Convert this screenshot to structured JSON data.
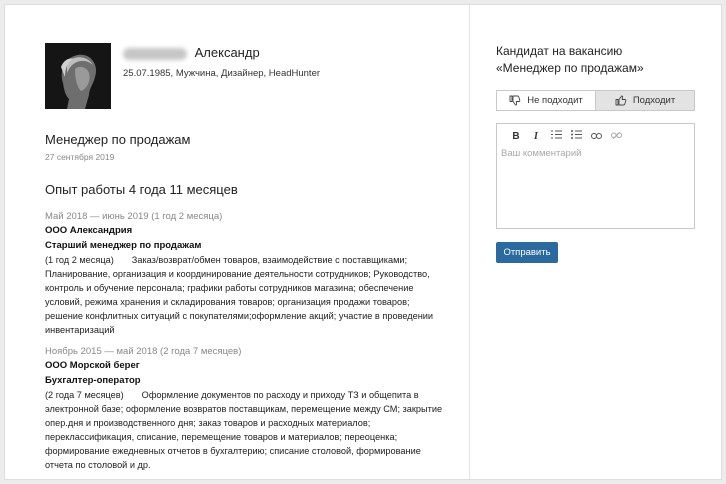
{
  "candidate": {
    "first_name": "Александр",
    "meta": "25.07.1985, Мужчина, Дизайнер, HeadHunter"
  },
  "resume": {
    "position_title": "Менеджер по продажам",
    "position_date": "27 сентября 2019",
    "experience_header": "Опыт работы 4 года 11 месяцев",
    "jobs": [
      {
        "period": "Май 2018 — июнь 2019 (1 год 2 месяца)",
        "company": "ООО Александрия",
        "role": "Старший менеджер по продажам",
        "duration": "(1 год 2 месяца)",
        "description": "Заказ/возврат/обмен товаров, взаимодействие с поставщиками; Планирование, организация и координирование деятельности сотрудников; Руководство, контроль и обучение персонала; графики работы сотрудников магазина; обеспечение условий, режима хранения и складирования товаров; организация продажи товаров; решение конфлитных ситуаций с покупателями;оформление акций; участие в проведении инвентаризаций"
      },
      {
        "period": "Ноябрь 2015 — май 2018 (2 года 7 месяцев)",
        "company": "ООО Морской берег",
        "role": "Бухгалтер-оператор",
        "duration": "(2 года 7 месяцев)",
        "description": "Оформление документов по расходу и приходу ТЗ и общепита в электронной базе; оформление возвратов поставщикам, перемещение между СМ; закрытие опер.дня и производственного дня; заказ товаров и расходных материалов; перекласcификация, списание, перемещение товаров и материалов; переоценка; формирование ежедневных отчетов в бухгалтерию; списание столовой, формирование отчета по столовой и др."
      }
    ]
  },
  "sidebar": {
    "title_line1": "Кандидат на вакансию",
    "title_line2": "«Менеджер по продажам»",
    "reject_label": "Не подходит",
    "accept_label": "Подходит",
    "comment_placeholder": "Ваш комментарий",
    "send_label": "Отправить",
    "toolbar": {
      "bold": "B",
      "italic": "I"
    }
  },
  "colors": {
    "accent": "#2b6a9e",
    "active_toggle": "#e3e3e3"
  }
}
